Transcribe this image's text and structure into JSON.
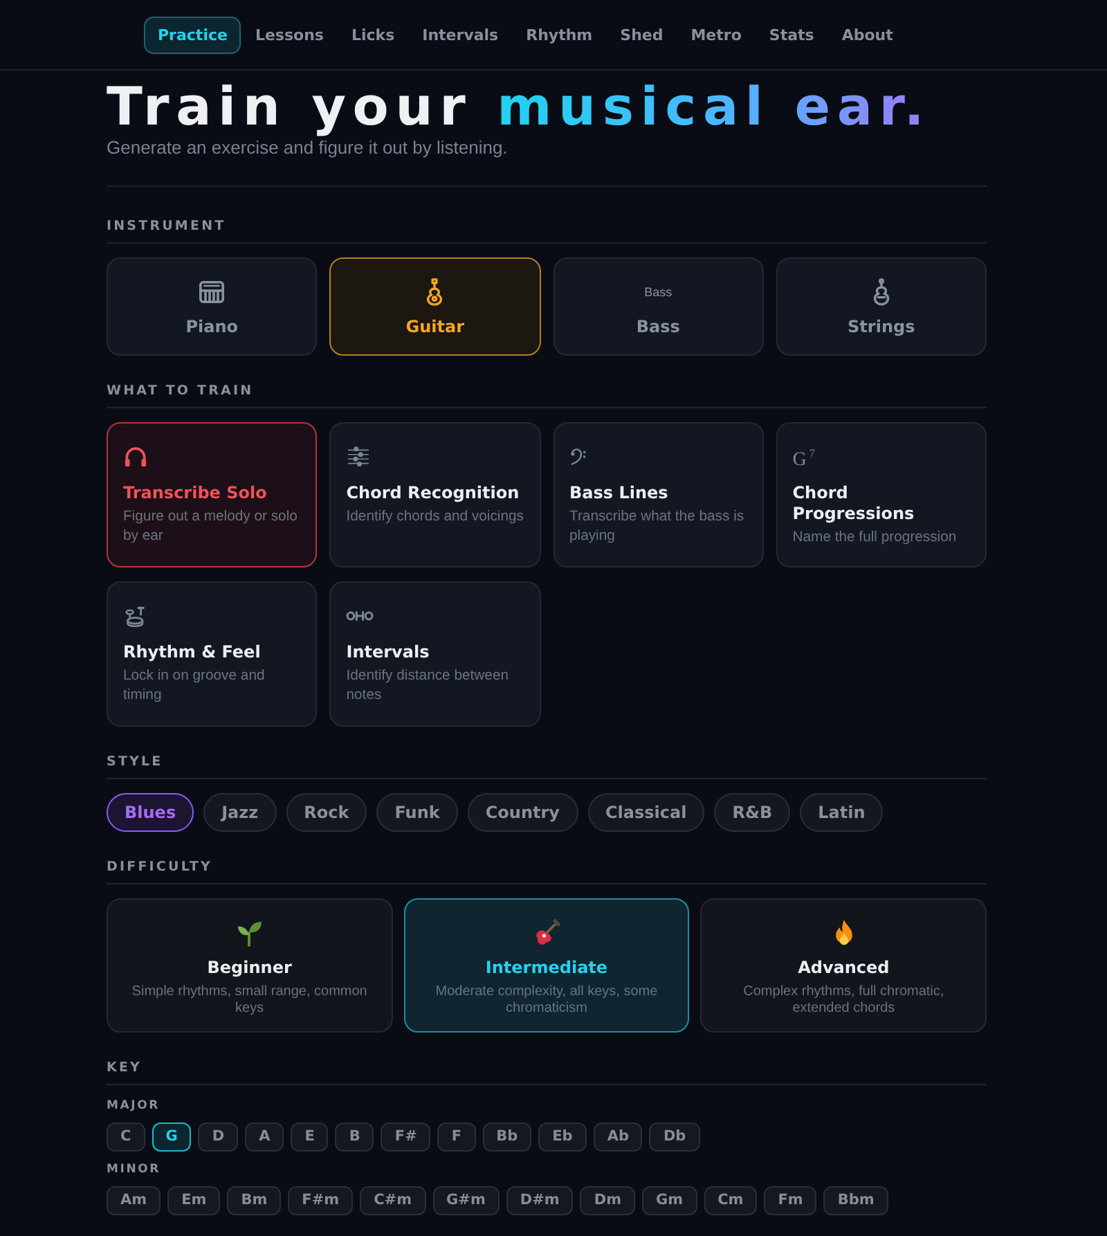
{
  "nav": {
    "items": [
      {
        "label": "Practice",
        "selected": true
      },
      {
        "label": "Lessons",
        "selected": false
      },
      {
        "label": "Licks",
        "selected": false
      },
      {
        "label": "Intervals",
        "selected": false
      },
      {
        "label": "Rhythm",
        "selected": false
      },
      {
        "label": "Shed",
        "selected": false
      },
      {
        "label": "Metro",
        "selected": false
      },
      {
        "label": "Stats",
        "selected": false
      },
      {
        "label": "About",
        "selected": false
      }
    ]
  },
  "hero": {
    "title": "Train your",
    "title_highlight": "musical ear.",
    "subtitle": "Generate an exercise and figure it out by listening."
  },
  "instrument": {
    "label": "INSTRUMENT",
    "options": [
      {
        "label": "Piano",
        "selected": false
      },
      {
        "label": "Guitar",
        "selected": true
      },
      {
        "label": "Bass",
        "icon_text": "Bass",
        "selected": false
      },
      {
        "label": "Strings",
        "selected": false
      }
    ]
  },
  "train": {
    "label": "WHAT TO TRAIN",
    "options": [
      {
        "title": "Transcribe Solo",
        "description": "Figure out a melody or solo by ear",
        "selected": true
      },
      {
        "title": "Chord Recognition",
        "description": "Identify chords and voicings",
        "selected": false
      },
      {
        "title": "Bass Lines",
        "description": "Transcribe what the bass is playing",
        "selected": false
      },
      {
        "title": "Chord Progressions",
        "icon_text": "G$^{7}$",
        "description": "Name the full progression",
        "selected": false
      },
      {
        "title": "Rhythm & Feel",
        "description": "Lock in on groove and timing",
        "selected": false
      },
      {
        "title": "Intervals",
        "description": "Identify distance between notes",
        "selected": false
      }
    ]
  },
  "style": {
    "label": "STYLE",
    "options": [
      {
        "label": "Blues",
        "selected": true
      },
      {
        "label": "Jazz",
        "selected": false
      },
      {
        "label": "Rock",
        "selected": false
      },
      {
        "label": "Funk",
        "selected": false
      },
      {
        "label": "Country",
        "selected": false
      },
      {
        "label": "Classical",
        "selected": false
      },
      {
        "label": "R&B",
        "selected": false
      },
      {
        "label": "Latin",
        "selected": false
      }
    ]
  },
  "difficulty": {
    "label": "DIFFICULTY",
    "options": [
      {
        "title": "Beginner",
        "description": "Simple rhythms, small range, common keys",
        "selected": false
      },
      {
        "title": "Intermediate",
        "description": "Moderate complexity, all keys, some chromaticism",
        "selected": true
      },
      {
        "title": "Advanced",
        "description": "Complex rhythms, full chromatic, extended chords",
        "selected": false
      }
    ]
  },
  "key": {
    "label": "KEY",
    "groups": [
      {
        "label": "MAJOR",
        "keys": [
          {
            "label": "C",
            "selected": false
          },
          {
            "label": "G",
            "selected": true
          },
          {
            "label": "D",
            "selected": false
          },
          {
            "label": "A",
            "selected": false
          },
          {
            "label": "E",
            "selected": false
          },
          {
            "label": "B",
            "selected": false
          },
          {
            "label": "F#",
            "selected": false
          },
          {
            "label": "F",
            "selected": false
          },
          {
            "label": "Bb",
            "selected": false
          },
          {
            "label": "Eb",
            "selected": false
          },
          {
            "label": "Ab",
            "selected": false
          },
          {
            "label": "Db",
            "selected": false
          }
        ]
      },
      {
        "label": "MINOR",
        "keys": [
          {
            "label": "Am",
            "selected": false
          },
          {
            "label": "Em",
            "selected": false
          },
          {
            "label": "Bm",
            "selected": false
          },
          {
            "label": "F#m",
            "selected": false
          },
          {
            "label": "C#m",
            "selected": false
          },
          {
            "label": "G#m",
            "selected": false
          },
          {
            "label": "D#m",
            "selected": false
          },
          {
            "label": "Dm",
            "selected": false
          },
          {
            "label": "Gm",
            "selected": false
          },
          {
            "label": "Cm",
            "selected": false
          },
          {
            "label": "Fm",
            "selected": false
          },
          {
            "label": "Bbm",
            "selected": false
          }
        ]
      }
    ]
  }
}
